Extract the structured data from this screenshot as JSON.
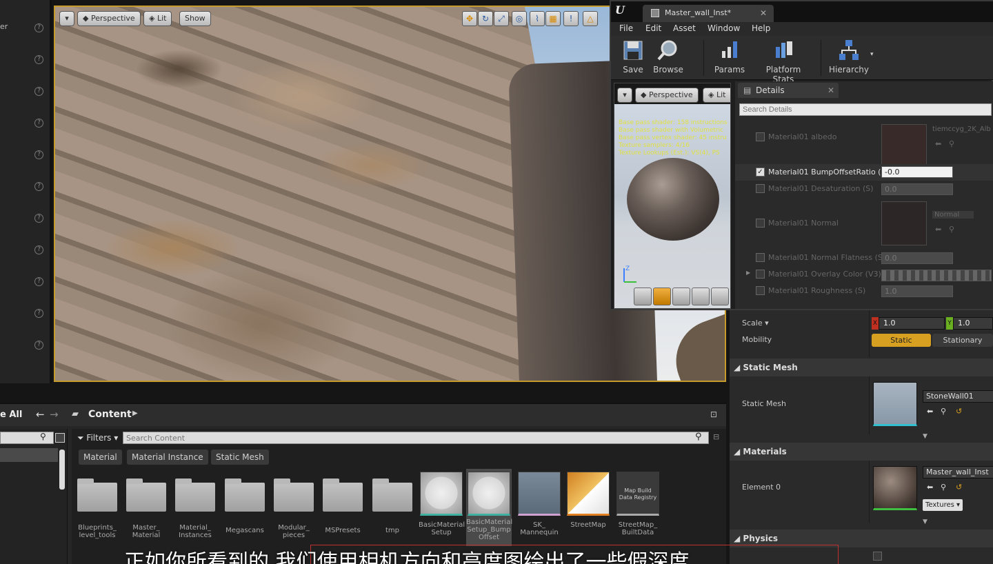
{
  "left_strip": {
    "cut_label": "er"
  },
  "viewport": {
    "perspective_label": "Perspective",
    "lit_label": "Lit",
    "show_label": "Show"
  },
  "material_editor": {
    "tab_title": "Master_wall_Inst*",
    "menu": [
      "File",
      "Edit",
      "Asset",
      "Window",
      "Help"
    ],
    "toolbar": {
      "save": "Save",
      "browse": "Browse",
      "params": "Params",
      "platform_stats": "Platform Stats",
      "hierarchy": "Hierarchy"
    },
    "preview": {
      "perspective_label": "Perspective",
      "lit_label": "Lit",
      "stats": [
        "Base pass shader: 158 instructions",
        "Base pass shader with Volumetric",
        "Base pass vertex shader: 45 instru",
        "Texture samplers: 4/16",
        "Texture Lookups (Est.): VS(4), PS"
      ]
    },
    "details": {
      "tab_label": "Details",
      "search_placeholder": "Search Details",
      "params": [
        {
          "label": "Material01 albedo",
          "texture": "tiemccyg_2K_Alb"
        },
        {
          "label": "Material01 BumpOffsetRatio (S)",
          "value": "-0.0",
          "checked": true
        },
        {
          "label": "Material01 Desaturation (S)",
          "value": "0.0"
        },
        {
          "label": "Material01 Normal",
          "texture": "Normal"
        },
        {
          "label": "Material01 Normal Flatness (S)",
          "value": "0.0"
        },
        {
          "label": "Material01 Overlay Color (V3)"
        },
        {
          "label": "Material01 Roughness (S)",
          "value": "1.0"
        }
      ]
    }
  },
  "right_panel": {
    "scale_label": "Scale",
    "scale_x": "1.0",
    "scale_y": "1.0",
    "mobility_label": "Mobility",
    "mobility_static": "Static",
    "mobility_stationary": "Stationary",
    "static_mesh_section": "Static Mesh",
    "static_mesh_label": "Static Mesh",
    "static_mesh_value": "StoneWall01",
    "materials_section": "Materials",
    "element_label": "Element 0",
    "material_value": "Master_wall_Inst",
    "textures_label": "Textures",
    "physics_section": "Physics"
  },
  "content_browser": {
    "left_cut_label": "e All",
    "path_label": "Content",
    "filters_label": "Filters",
    "search_placeholder": "Search Content",
    "filter_chips": [
      "Material",
      "Material Instance",
      "Static Mesh"
    ],
    "assets": [
      {
        "label": "Blueprints_ level_tools",
        "kind": "folder"
      },
      {
        "label": "Master_ Material",
        "kind": "folder"
      },
      {
        "label": "Material_ Instances",
        "kind": "folder"
      },
      {
        "label": "Megascans",
        "kind": "folder"
      },
      {
        "label": "Modular_ pieces",
        "kind": "folder"
      },
      {
        "label": "MSPresets",
        "kind": "folder"
      },
      {
        "label": "tmp",
        "kind": "folder"
      },
      {
        "label": "BasicMaterial Setup",
        "kind": "material"
      },
      {
        "label": "BasicMaterial Setup_Bump Offset",
        "kind": "material"
      },
      {
        "label": "SK_ Mannequin",
        "kind": "mesh"
      },
      {
        "label": "StreetMap",
        "kind": "streetmap"
      },
      {
        "label": "StreetMap_ BuiltData",
        "kind": "registry",
        "thumb_text": "Map Build Data Registry"
      }
    ]
  },
  "subtitle": "正如你所看到的 我们使用相机方向和高度图绘出了一些假深度"
}
